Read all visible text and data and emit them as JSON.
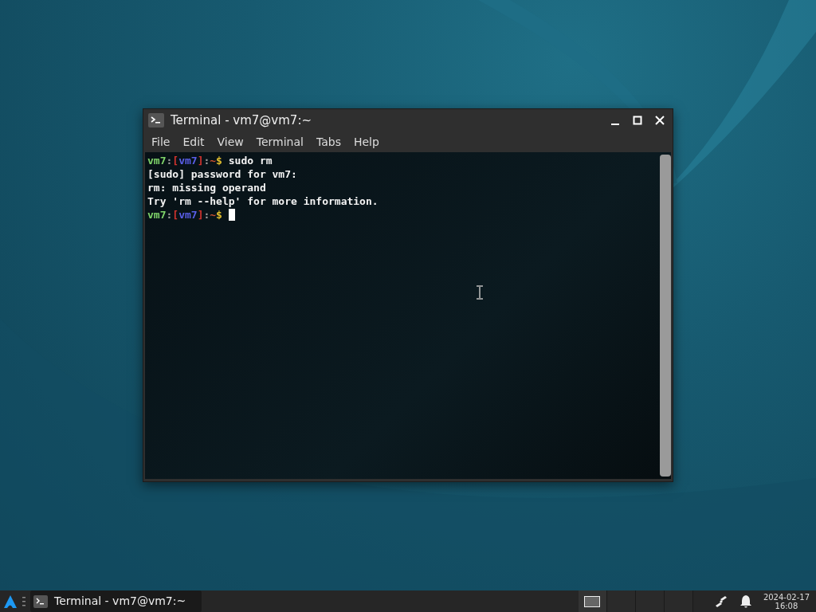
{
  "window": {
    "title": "Terminal - vm7@vm7:~"
  },
  "menu": [
    {
      "label": "File"
    },
    {
      "label": "Edit"
    },
    {
      "label": "View"
    },
    {
      "label": "Terminal"
    },
    {
      "label": "Tabs"
    },
    {
      "label": "Help"
    }
  ],
  "terminal": {
    "lines": [
      {
        "kind": "prompt",
        "segments": [
          {
            "text": "vm7",
            "color": "#7fd46a"
          },
          {
            "text": ":",
            "color": "#9a9a9a"
          },
          {
            "text": "[",
            "color": "#d0332e"
          },
          {
            "text": "vm7",
            "color": "#5a5ee8"
          },
          {
            "text": "]",
            "color": "#d0332e"
          },
          {
            "text": ":",
            "color": "#9a9a9a"
          },
          {
            "text": "~",
            "color": "#d2522e"
          },
          {
            "text": "$",
            "color": "#e6c22e"
          }
        ],
        "command": "sudo rm",
        "cursor": false
      },
      {
        "kind": "output",
        "text": "[sudo] password for vm7:"
      },
      {
        "kind": "output",
        "text": "rm: missing operand"
      },
      {
        "kind": "output",
        "text": "Try 'rm --help' for more information."
      },
      {
        "kind": "prompt",
        "segments": [
          {
            "text": "vm7",
            "color": "#7fd46a"
          },
          {
            "text": ":",
            "color": "#9a9a9a"
          },
          {
            "text": "[",
            "color": "#d0332e"
          },
          {
            "text": "vm7",
            "color": "#5a5ee8"
          },
          {
            "text": "]",
            "color": "#d0332e"
          },
          {
            "text": ":",
            "color": "#9a9a9a"
          },
          {
            "text": "~",
            "color": "#d2522e"
          },
          {
            "text": "$",
            "color": "#e6c22e"
          }
        ],
        "cursor": true
      }
    ]
  },
  "taskbar": {
    "tasks": [
      {
        "label": "Terminal - vm7@vm7:~",
        "selected": true
      }
    ],
    "workspaces": [
      {
        "selected": true
      },
      {
        "selected": false
      },
      {
        "selected": false
      },
      {
        "selected": false
      }
    ],
    "clock": {
      "date": "2024-02-17",
      "time": "16:08"
    }
  }
}
